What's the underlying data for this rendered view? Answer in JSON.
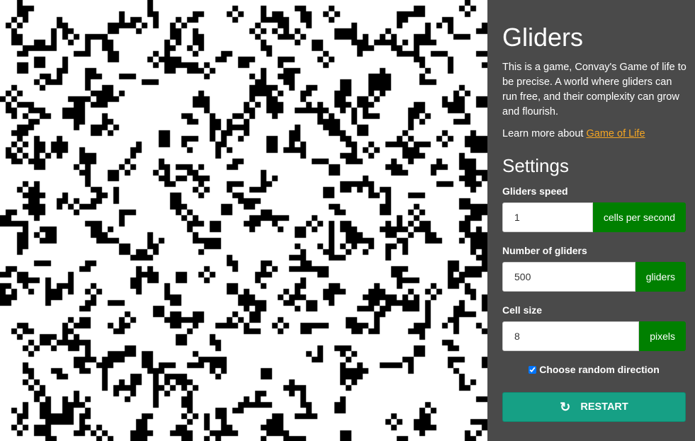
{
  "world": {
    "alive_color": "#000000",
    "dead_color": "#ffffff"
  },
  "panel": {
    "title": "Gliders",
    "description": "This is a game, Convay's Game of life to be precise. A world where gliders can run free, and their complexity can grow and flourish.",
    "learn_more_prefix": "Learn more about ",
    "learn_more_link": "Game of Life",
    "settings_heading": "Settings",
    "speed": {
      "label": "Gliders speed",
      "value": "1",
      "unit": "cells per second"
    },
    "count": {
      "label": "Number of gliders",
      "value": "500",
      "unit": "gliders"
    },
    "cell_size": {
      "label": "Cell size",
      "value": "8",
      "unit": "pixels"
    },
    "random_direction": {
      "label": "Choose random direction",
      "checked": true
    },
    "restart": {
      "label": "RESTART",
      "icon": "refresh-icon"
    }
  },
  "colors": {
    "panel_bg": "#4a4a4a",
    "accent_green": "#008000",
    "link_orange": "#f5a623",
    "button_teal": "#16a085"
  }
}
